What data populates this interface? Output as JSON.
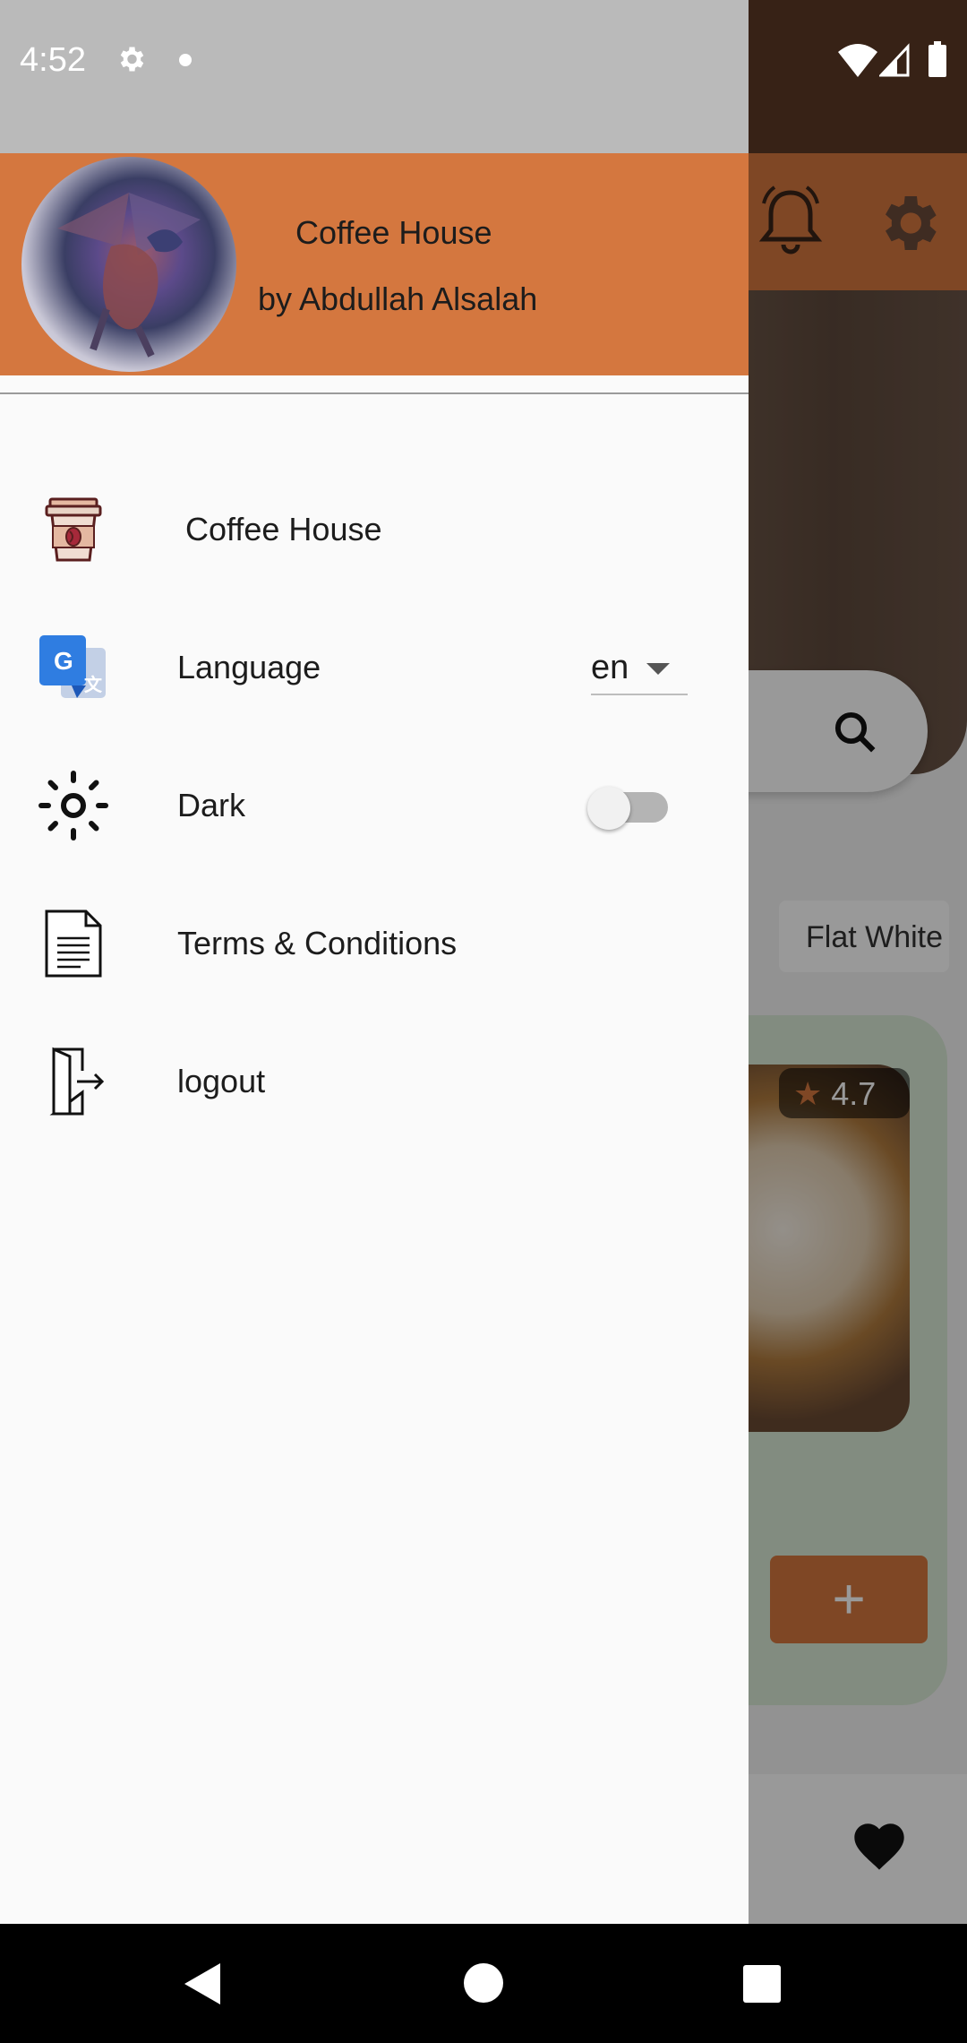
{
  "status_bar": {
    "time": "4:52",
    "icons": [
      "settings-icon",
      "notification-dot",
      "wifi-icon",
      "signal-icon",
      "battery-icon"
    ]
  },
  "background": {
    "chip_label": "Flat White",
    "rating": "4.7",
    "add_label": "+",
    "icons": [
      "bell-icon",
      "gear-icon",
      "search-icon",
      "star-icon",
      "heart-icon"
    ]
  },
  "drawer": {
    "header": {
      "title": "Coffee House",
      "subtitle": "by Abdullah Alsalah"
    },
    "items": [
      {
        "label": "Coffee House",
        "icon": "coffee-cup-icon"
      },
      {
        "label": "Language",
        "icon": "google-translate-icon",
        "control": {
          "type": "select",
          "value": "en"
        }
      },
      {
        "label": "Dark",
        "icon": "brightness-icon",
        "control": {
          "type": "switch",
          "on": false
        }
      },
      {
        "label": "Terms & Conditions",
        "icon": "document-icon"
      },
      {
        "label": "logout",
        "icon": "logout-door-icon"
      }
    ]
  },
  "colors": {
    "accent": "#d4773f",
    "drawer_bg": "#fafafa",
    "status_bg": "#bababa"
  },
  "nav_bar": {
    "icons": [
      "back-icon",
      "home-icon",
      "recents-icon"
    ]
  }
}
